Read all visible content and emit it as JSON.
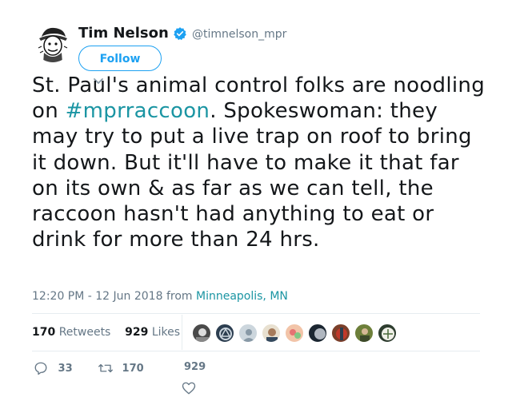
{
  "user": {
    "name": "Tim Nelson",
    "handle": "@timnelson_mpr",
    "follow_label": "Follow"
  },
  "tweet": {
    "text_before": "St. Paul's animal control folks are noodling on ",
    "hashtag": "#mprraccoon",
    "text_after": ". Spokeswoman: they may try to put a live trap on roof to bring it down. But it'll have to make it that far on its own & as far as we can tell, the raccoon hasn't had anything to eat or drink for more than 24 hrs."
  },
  "meta": {
    "timestamp": "12:20 PM - 12 Jun 2018",
    "from_label": "from",
    "location": "Minneapolis, MN"
  },
  "stats": {
    "retweets_count": "170",
    "retweets_label": "Retweets",
    "likes_count": "929",
    "likes_label": "Likes"
  },
  "actions": {
    "replies": "33",
    "retweets": "170",
    "likes": "929"
  },
  "colors": {
    "accent": "#1da1f2",
    "link": "#1b95a3",
    "muted": "#657786"
  }
}
